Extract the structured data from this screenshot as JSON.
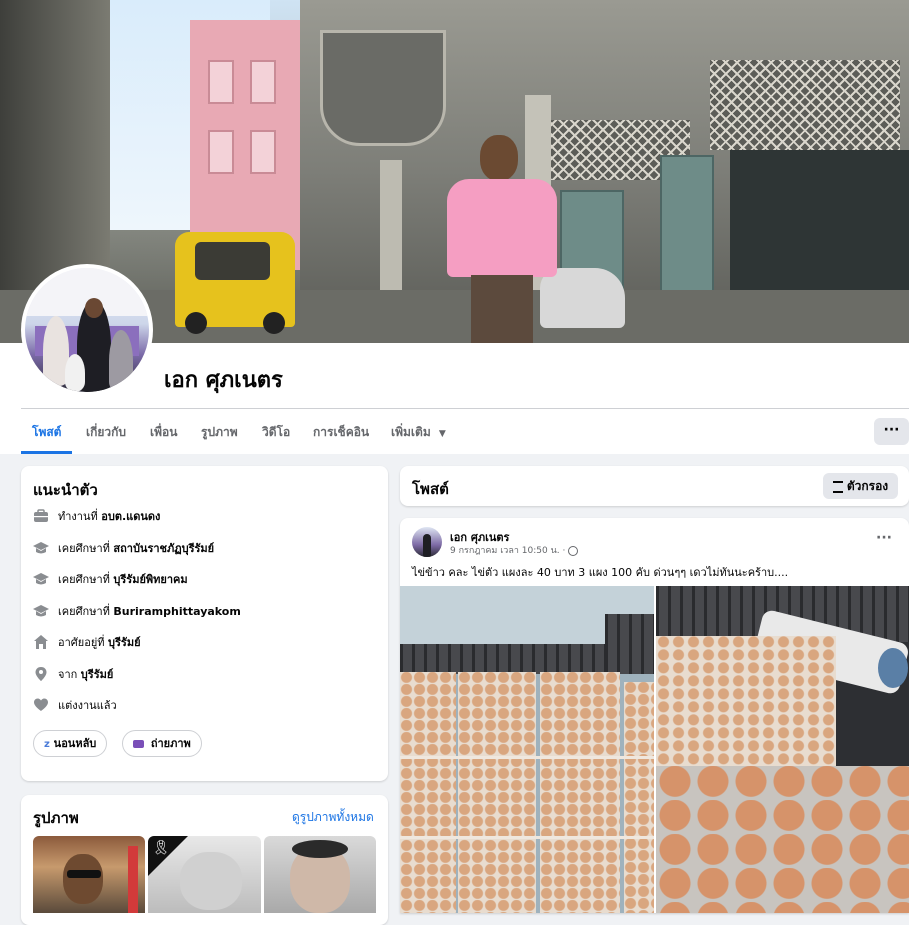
{
  "profile": {
    "name": "เอก ศุภเนตร"
  },
  "tabs": [
    {
      "label": "โพสต์",
      "active": true
    },
    {
      "label": "เกี่ยวกับ"
    },
    {
      "label": "เพื่อน"
    },
    {
      "label": "รูปภาพ"
    },
    {
      "label": "วิดีโอ"
    },
    {
      "label": "การเช็คอิน"
    },
    {
      "label": "เพิ่มเติม"
    }
  ],
  "more_button": "···",
  "intro": {
    "title": "แนะนำตัว",
    "rows": [
      {
        "icon": "briefcase-icon",
        "prefix": "ทำงานที่ ",
        "value": "อบต.แดนดง"
      },
      {
        "icon": "graduation-cap-icon",
        "prefix": "เคยศึกษาที่ ",
        "value": "สถาบันราชภัฏบุรีรัมย์"
      },
      {
        "icon": "graduation-cap-icon",
        "prefix": "เคยศึกษาที่ ",
        "value": "บุรีรัมย์พิทยาคม"
      },
      {
        "icon": "graduation-cap-icon",
        "prefix": "เคยศึกษาที่ ",
        "value": "Buriramphittayakom"
      },
      {
        "icon": "home-icon",
        "prefix": "อาศัยอยู่ที่ ",
        "value": "บุรีรัมย์"
      },
      {
        "icon": "location-pin-icon",
        "prefix": "จาก ",
        "value": "บุรีรัมย์"
      },
      {
        "icon": "heart-icon",
        "prefix": "แต่งงานแล้ว",
        "value": ""
      }
    ],
    "hobbies": [
      {
        "icon": "sleep-icon",
        "label": "นอนหลับ"
      },
      {
        "icon": "camera-icon",
        "label": "ถ่ายภาพ"
      }
    ]
  },
  "photos": {
    "title": "รูปภาพ",
    "see_all": "ดูรูปภาพทั้งหมด"
  },
  "posts_header": {
    "title": "โพสต์",
    "filter": "ตัวกรอง"
  },
  "post": {
    "author": "เอก ศุภเนตร",
    "time": "9 กรกฎาคม เวลา 10:50 น. ·",
    "text": "ไข่ข้าว คละ ไข่ตัว แผงละ 40 บาท 3 แผง 100 คับ ด่วนๆๆ เดวไม่ทันนะคร้าบ....",
    "menu": "···"
  },
  "colors": {
    "accent": "#1b74e4",
    "page_bg": "#f0f2f5",
    "muted": "#65676b"
  }
}
